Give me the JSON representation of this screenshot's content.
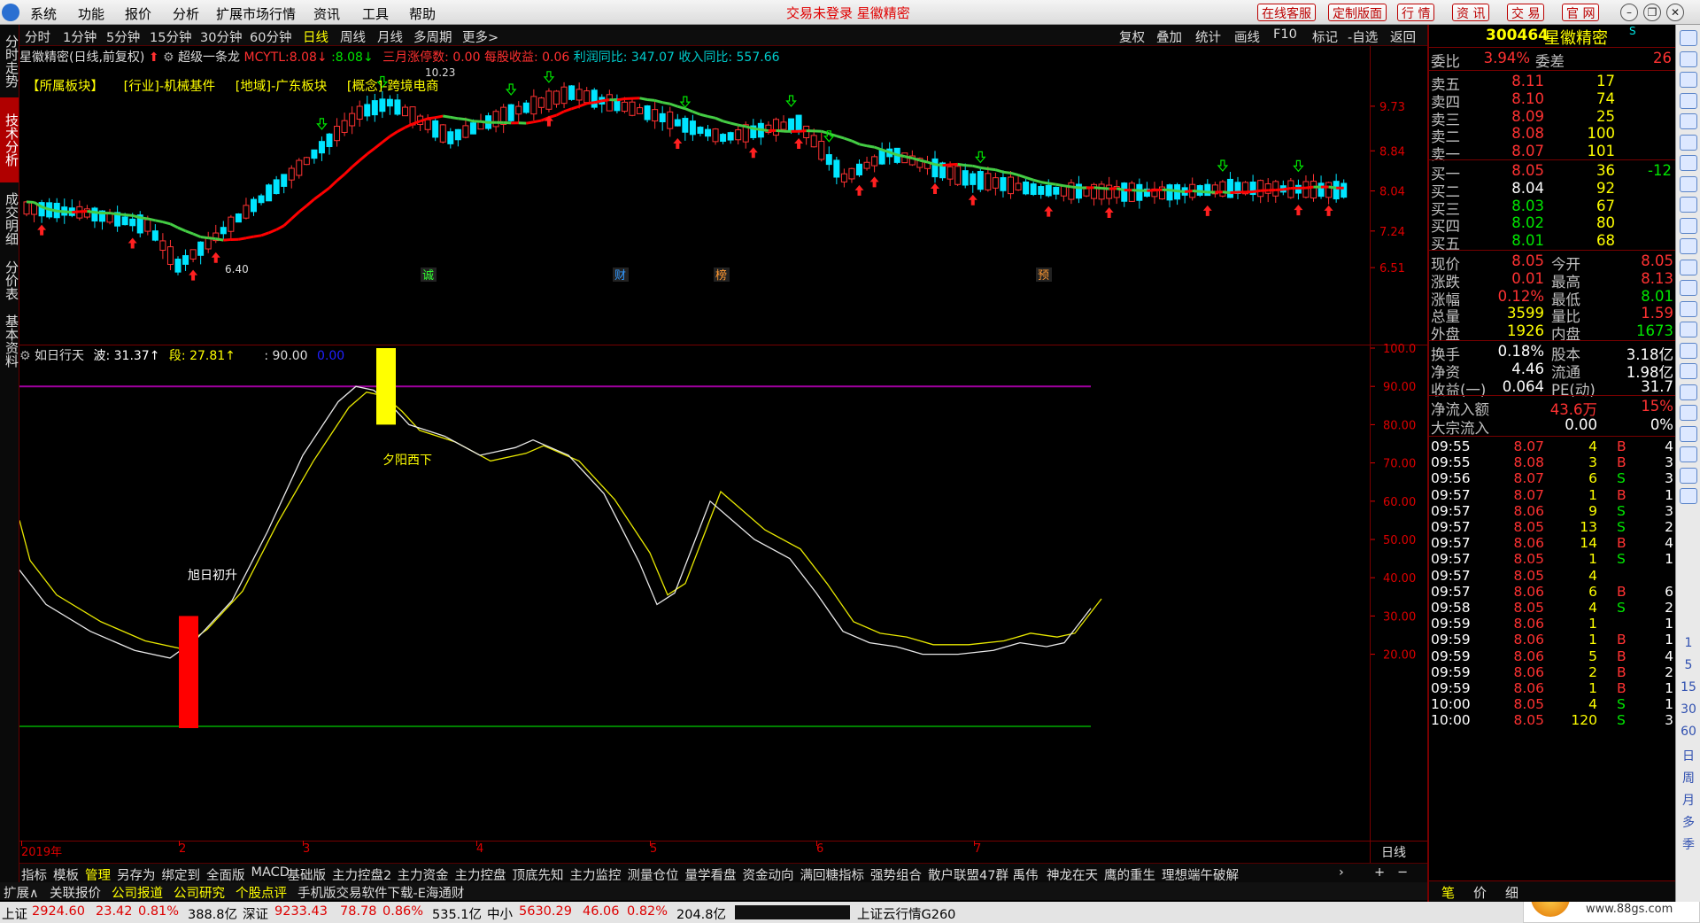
{
  "menubar": {
    "items": [
      "系统",
      "功能",
      "报价",
      "分析",
      "扩展市场行情",
      "资讯",
      "工具",
      "帮助"
    ],
    "alert": "交易未登录 星徽精密",
    "buttons": [
      "在线客服",
      "定制版面",
      "行 情",
      "资 讯",
      "交 易",
      "官 网"
    ]
  },
  "left_tabs": [
    "分时走势",
    "技术分析",
    "成交明细",
    "分价表",
    "基本资料"
  ],
  "toolbar": {
    "periods": [
      "分时",
      "1分钟",
      "5分钟",
      "15分钟",
      "30分钟",
      "60分钟",
      "日线",
      "周线",
      "月线",
      "多周期",
      "更多>"
    ],
    "active": "日线",
    "right": [
      "复权",
      "叠加",
      "统计",
      "画线",
      "F10",
      "标记",
      "-自选",
      "返回"
    ]
  },
  "info": {
    "stock": "星徽精密(日线,前复权)",
    "indicator": "超级一条龙",
    "mcytl_label": "MCYTL:",
    "mcytl_v1": "8.08↓",
    "mcytl_v2": ":8.08↓",
    "limit_text": "三月涨停数: 0.00",
    "eps_text": "每股收益: 0.06",
    "profit_text": "利润同比: 347.07",
    "revenue_text": "收入同比: 557.66"
  },
  "sectors": [
    "【所属板块】",
    "[行业]-机械基件",
    "[地域]-广东板块",
    "[概念]-跨境电商"
  ],
  "price_axis": [
    "9.73",
    "8.84",
    "8.04",
    "7.24",
    "6.51"
  ],
  "price_marks": {
    "high": "10.23",
    "low": "6.40"
  },
  "event_markers": [
    "诚",
    "财",
    "榜",
    "预"
  ],
  "osc": {
    "name": "如日行天",
    "wave": "波: 31.37↑",
    "seg": "段: 27.81↑",
    "level": ": 90.00",
    "zero": "0.00",
    "axis": [
      "100.0",
      "90.00",
      "80.00",
      "70.00",
      "60.00",
      "50.00",
      "40.00",
      "30.00",
      "20.00"
    ],
    "label_up": "旭日初升",
    "label_down": "夕阳西下"
  },
  "date_axis": [
    "2019年",
    "2",
    "3",
    "4",
    "5",
    "6",
    "7"
  ],
  "period_label": "日线",
  "bottom_tabs": [
    "指标",
    "模板",
    "管理",
    "另存为",
    "绑定到",
    "全面版",
    "MACD",
    "基础版",
    "主力控盘2",
    "主力资金",
    "主力控盘",
    "顶底先知",
    "主力监控",
    "测量仓位",
    "量学看盘",
    "资金动向",
    "满回糖指标",
    "强势组合",
    "散户联盟47群 禹伟",
    "神龙在天",
    "鹰的重生",
    "理想端午破解"
  ],
  "bottom_tabs_active": "管理",
  "bottom_right": [
    "+",
    "−"
  ],
  "tabs2": [
    "扩展∧",
    "关联报价",
    "公司报道",
    "公司研究",
    "个股点评",
    "手机版交易软件下载-E海通财"
  ],
  "status": {
    "sh_name": "上证",
    "sh_price": "2924.60",
    "sh_chg": "23.42",
    "sh_pct": "0.81%",
    "sh_vol": "388.8亿",
    "sz_name": "深证",
    "sz_price": "9233.43",
    "sz_chg": "78.78",
    "sz_pct": "0.86%",
    "sz_vol": "535.1亿",
    "zx_name": "中小",
    "zx_price": "5630.29",
    "zx_chg": "46.06",
    "zx_pct": "0.82%",
    "zx_vol": "204.8亿",
    "cloud": "上证云行情G260"
  },
  "quote": {
    "code": "300464",
    "name": "星徽精密",
    "weibi_label": "委比",
    "weibi": "3.94%",
    "weicha_label": "委差",
    "weicha": "26",
    "asks": [
      {
        "label": "卖五",
        "price": "8.11",
        "vol": "17"
      },
      {
        "label": "卖四",
        "price": "8.10",
        "vol": "74"
      },
      {
        "label": "卖三",
        "price": "8.09",
        "vol": "25"
      },
      {
        "label": "卖二",
        "price": "8.08",
        "vol": "100"
      },
      {
        "label": "卖一",
        "price": "8.07",
        "vol": "101"
      }
    ],
    "bids": [
      {
        "label": "买一",
        "price": "8.05",
        "vol": "36",
        "chg": "-12"
      },
      {
        "label": "买二",
        "price": "8.04",
        "vol": "92",
        "chg": ""
      },
      {
        "label": "买三",
        "price": "8.03",
        "vol": "67",
        "chg": ""
      },
      {
        "label": "买四",
        "price": "8.02",
        "vol": "80",
        "chg": ""
      },
      {
        "label": "买五",
        "price": "8.01",
        "vol": "68",
        "chg": ""
      }
    ],
    "stats": [
      {
        "l1": "现价",
        "v1": "8.05",
        "l2": "今开",
        "v2": "8.05"
      },
      {
        "l1": "涨跌",
        "v1": "0.01",
        "l2": "最高",
        "v2": "8.13"
      },
      {
        "l1": "涨幅",
        "v1": "0.12%",
        "l2": "最低",
        "v2": "8.01"
      },
      {
        "l1": "总量",
        "v1": "3599",
        "l2": "量比",
        "v2": "1.59"
      },
      {
        "l1": "外盘",
        "v1": "1926",
        "l2": "内盘",
        "v2": "1673"
      }
    ],
    "fin": [
      {
        "l1": "换手",
        "v1": "0.18%",
        "l2": "股本",
        "v2": "3.18亿"
      },
      {
        "l1": "净资",
        "v1": "4.46",
        "l2": "流通",
        "v2": "1.98亿"
      },
      {
        "l1": "收益(一)",
        "v1": "0.064",
        "l2": "PE(动)",
        "v2": "31.7"
      }
    ],
    "flow": [
      {
        "label": "净流入额",
        "v": "43.6万",
        "p": "15%"
      },
      {
        "label": "大宗流入",
        "v": "0.00",
        "p": "0%"
      }
    ],
    "ticks": [
      [
        "09:55",
        "8.07",
        "4",
        "B",
        "4"
      ],
      [
        "09:55",
        "8.08",
        "3",
        "B",
        "3"
      ],
      [
        "09:56",
        "8.07",
        "6",
        "S",
        "3"
      ],
      [
        "09:57",
        "8.07",
        "1",
        "B",
        "1"
      ],
      [
        "09:57",
        "8.06",
        "9",
        "S",
        "3"
      ],
      [
        "09:57",
        "8.05",
        "13",
        "S",
        "2"
      ],
      [
        "09:57",
        "8.06",
        "14",
        "B",
        "4"
      ],
      [
        "09:57",
        "8.05",
        "1",
        "S",
        "1"
      ],
      [
        "09:57",
        "8.05",
        "4",
        "",
        ""
      ],
      [
        "09:57",
        "8.06",
        "6",
        "B",
        "6"
      ],
      [
        "09:58",
        "8.05",
        "4",
        "S",
        "2"
      ],
      [
        "09:59",
        "8.06",
        "1",
        "",
        "1"
      ],
      [
        "09:59",
        "8.06",
        "1",
        "B",
        "1"
      ],
      [
        "09:59",
        "8.06",
        "5",
        "B",
        "4"
      ],
      [
        "09:59",
        "8.06",
        "2",
        "B",
        "2"
      ],
      [
        "09:59",
        "8.06",
        "1",
        "B",
        "1"
      ],
      [
        "10:00",
        "8.05",
        "4",
        "S",
        "1"
      ],
      [
        "10:00",
        "8.05",
        "120",
        "S",
        "3"
      ]
    ],
    "bottom_tabs": [
      "笔",
      "价",
      "细"
    ]
  },
  "right_numbers": [
    "1",
    "5",
    "15",
    "30",
    "60",
    "日",
    "周",
    "月",
    "多",
    "季"
  ],
  "colors": {
    "up": "#ff3232",
    "down": "#00e5ff",
    "ma_up": "#ff0000",
    "ma_down": "#44cc44",
    "osc_white": "#e8e8e8",
    "osc_yellow": "#e8e800",
    "level": "#a000a0",
    "signal_buy": "#ff0000",
    "signal_sell": "#ffff00"
  }
}
